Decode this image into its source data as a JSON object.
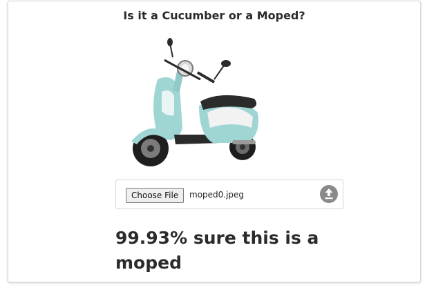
{
  "page": {
    "title": "Is it a Cucumber or a Moped?"
  },
  "image": {
    "subject": "moped",
    "alt": "",
    "colors": {
      "body": "#9fd6d4",
      "seat": "#2b2b2b",
      "trim": "#f2f2f2",
      "tire": "#1e1e1e"
    }
  },
  "file_input": {
    "button_label": "Choose File",
    "filename": "moped0.jpeg",
    "upload_icon": "upload-icon"
  },
  "result": {
    "text": "99.93% sure this is a moped"
  }
}
